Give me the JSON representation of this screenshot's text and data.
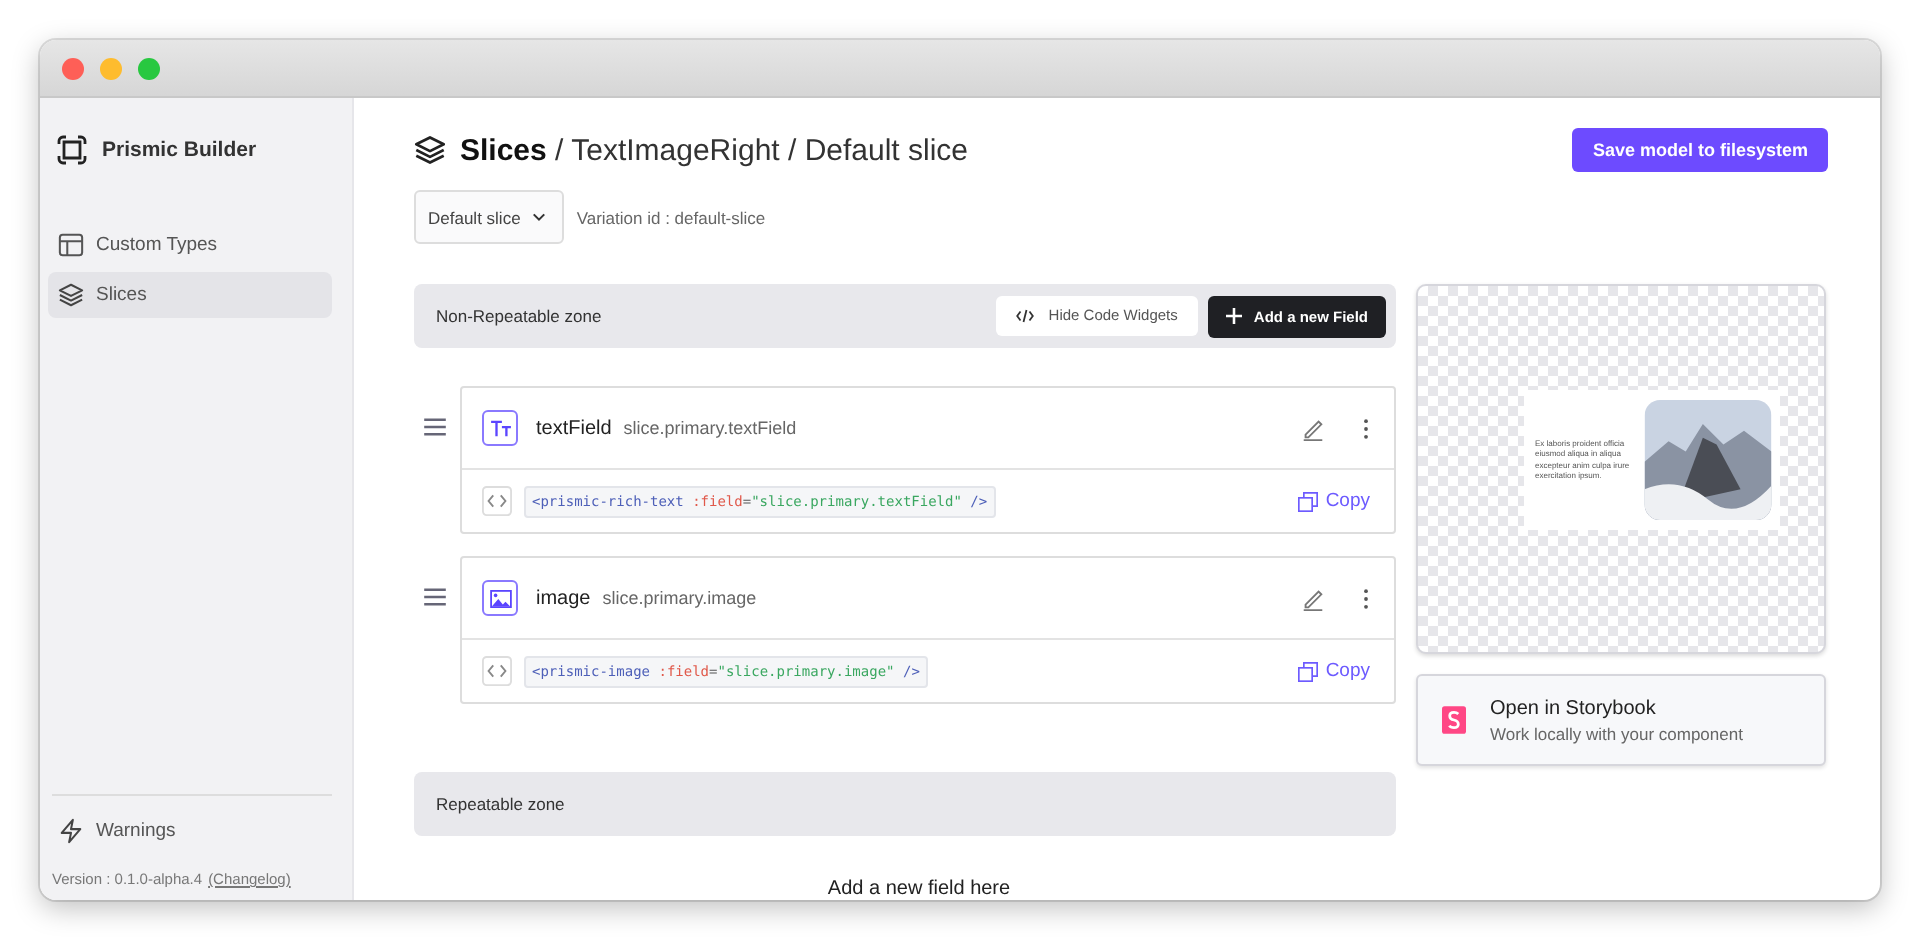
{
  "sidebar": {
    "brand": "Prismic Builder",
    "items": [
      {
        "label": "Custom Types",
        "kind": "layout",
        "selected": false
      },
      {
        "label": "Slices",
        "kind": "layers",
        "selected": true
      }
    ],
    "warnings": "Warnings",
    "version": "Version : 0.1.0-alpha.4",
    "changelog": "(Changelog)"
  },
  "header": {
    "section": "Slices",
    "path": " / TextImageRight / Default slice",
    "save_button": "Save model to filesystem"
  },
  "variation": {
    "select": "Default slice",
    "id_label": "Variation id : default-slice"
  },
  "non_repeatable": {
    "title": "Non-Repeatable zone",
    "hide_button": "Hide Code Widgets",
    "add_button": "Add a new Field",
    "fields": [
      {
        "name": "textField",
        "path": "slice.primary.textField",
        "kind": "text",
        "code": [
          {
            "kind": "tag",
            "text": "<prismic-rich-text"
          },
          {
            "kind": "attr",
            "text": " :field"
          },
          {
            "kind": "plain",
            "text": "="
          },
          {
            "kind": "value",
            "text": "\"slice.primary.textField\""
          },
          {
            "kind": "tag",
            "text": " />"
          }
        ],
        "copy": "Copy"
      },
      {
        "name": "image",
        "path": "slice.primary.image",
        "kind": "image",
        "code": [
          {
            "kind": "tag",
            "text": "<prismic-image"
          },
          {
            "kind": "attr",
            "text": " :field"
          },
          {
            "kind": "plain",
            "text": "="
          },
          {
            "kind": "value",
            "text": "\"slice.primary.image\""
          },
          {
            "kind": "tag",
            "text": " />"
          }
        ],
        "copy": "Copy"
      }
    ]
  },
  "repeatable": {
    "title": "Repeatable zone",
    "add_here": "Add a new field here"
  },
  "preview": {
    "text": "Ex laboris proident officia eiusmod aliqua in aliqua excepteur anim culpa irure exercitation ipsum."
  },
  "storybook": {
    "title": "Open in Storybook",
    "subtitle": "Work locally with your component"
  }
}
